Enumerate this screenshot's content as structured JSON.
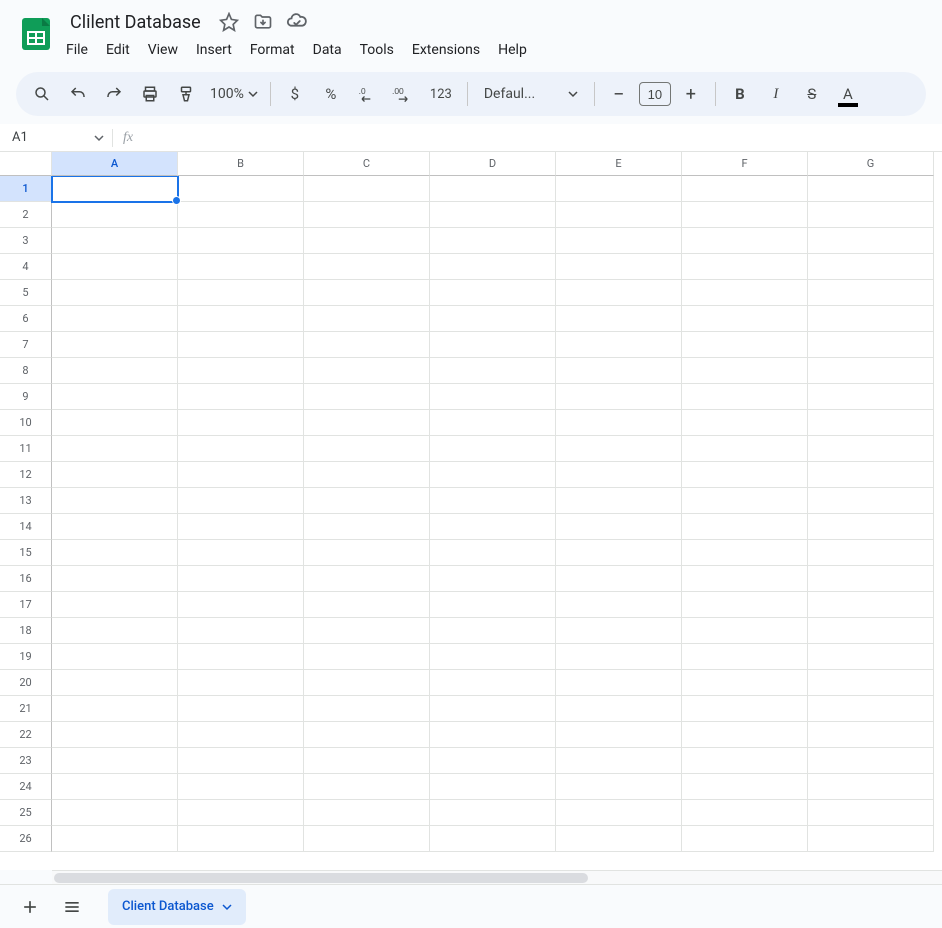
{
  "doc": {
    "title": "Clilent Database"
  },
  "menu": {
    "file": "File",
    "edit": "Edit",
    "view": "View",
    "insert": "Insert",
    "format": "Format",
    "data": "Data",
    "tools": "Tools",
    "extensions": "Extensions",
    "help": "Help"
  },
  "toolbar": {
    "zoom": "100%",
    "currency": "$",
    "percent": "%",
    "number_format": "123",
    "font_name": "Defaul...",
    "font_size": "10"
  },
  "name_box": "A1",
  "fx_label": "fx",
  "columns": [
    "A",
    "B",
    "C",
    "D",
    "E",
    "F",
    "G"
  ],
  "rows": [
    "1",
    "2",
    "3",
    "4",
    "5",
    "6",
    "7",
    "8",
    "9",
    "10",
    "11",
    "12",
    "13",
    "14",
    "15",
    "16",
    "17",
    "18",
    "19",
    "20",
    "21",
    "22",
    "23",
    "24",
    "25",
    "26"
  ],
  "selected_col": "A",
  "selected_row": "1",
  "sheets": {
    "active": "Client Database"
  }
}
